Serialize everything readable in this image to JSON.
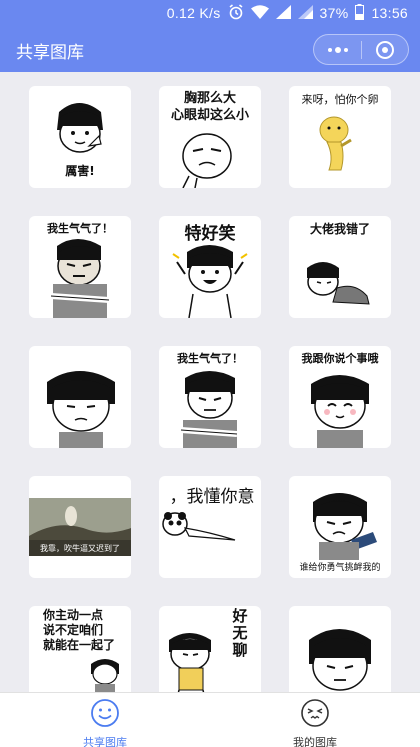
{
  "status_bar": {
    "speed": "0.12 K/s",
    "battery": "37%",
    "time": "13:56"
  },
  "nav": {
    "title": "共享图库"
  },
  "memes": [
    {
      "caption": "厲害!"
    },
    {
      "caption": "胸那么大\n心眼却这么小"
    },
    {
      "caption": "来呀，怕你个卵"
    },
    {
      "caption": "我生气气了！"
    },
    {
      "caption": "特好笑"
    },
    {
      "caption": "大佬我错了"
    },
    {
      "caption": ""
    },
    {
      "caption": "我生气气了！"
    },
    {
      "caption": "我跟你说个事哦"
    },
    {
      "caption": "我靠，吹牛逼又迟到了"
    },
    {
      "caption": "，我懂你意"
    },
    {
      "caption": "谁给你勇气挑衅我的"
    },
    {
      "caption": "你主动一点\n说不定咱们\n就能在一起了"
    },
    {
      "caption": "好\n无\n聊"
    },
    {
      "caption": ""
    }
  ],
  "tabs": [
    {
      "label": "共享图库",
      "icon": "smile-face-icon",
      "active": true
    },
    {
      "label": "我的图库",
      "icon": "sneaky-face-icon",
      "active": false
    }
  ],
  "colors": {
    "brand": "#6a88f0",
    "tab_active": "#4b7cf0",
    "background": "#ececf1"
  }
}
